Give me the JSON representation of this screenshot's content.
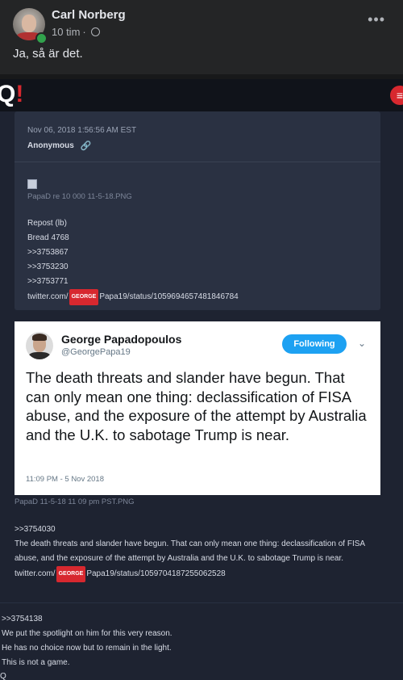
{
  "post": {
    "author": "Carl Norberg",
    "time": "10 tim",
    "separator": "·",
    "text": "Ja, så är det.",
    "more": "•••"
  },
  "site": {
    "logo_letter": "Q",
    "logo_bang": "!",
    "menu_icon": "≡"
  },
  "qdrop": {
    "date": "Nov 06, 2018 1:56:56 AM EST",
    "author": "Anonymous",
    "image_file": "PapaD re 10 000 11-5-18.PNG",
    "lines": [
      "Repost (lb)",
      "Bread 4768",
      ">>3753867",
      ">>3753230",
      ">>3753771"
    ],
    "link_prefix": "twitter.com/",
    "badge": "GEORGE",
    "link_suffix": "Papa19/status/1059694657481846784"
  },
  "tweet": {
    "name": "George Papadopoulos",
    "handle": "@GeorgePapa19",
    "follow_label": "Following",
    "text": "The death threats and slander have begun. That can only mean one thing: declassification of FISA abuse, and the exposure of the attempt by Australia and the U.K. to sabotage Trump is near.",
    "time": "11:09 PM - 5 Nov 2018"
  },
  "tweet_caption": "PapaD 11-5-18 11 09 pm PST.PNG",
  "reply": {
    "ref": ">>3754030",
    "text": "The death threats and slander have begun. That can only mean one thing: declassification of FISA abuse, and the exposure of the attempt by Australia and the U.K. to sabotage Trump is near.",
    "link_prefix": "twitter.com/",
    "badge": "GEORGE",
    "link_suffix": "Papa19/status/1059704187255062528"
  },
  "bottom": {
    "lines": [
      ">>3754138",
      "We put the spotlight on him for this very reason.",
      "He has no choice now but to remain in the light.",
      "This is not a game."
    ],
    "fragment": "Q"
  }
}
